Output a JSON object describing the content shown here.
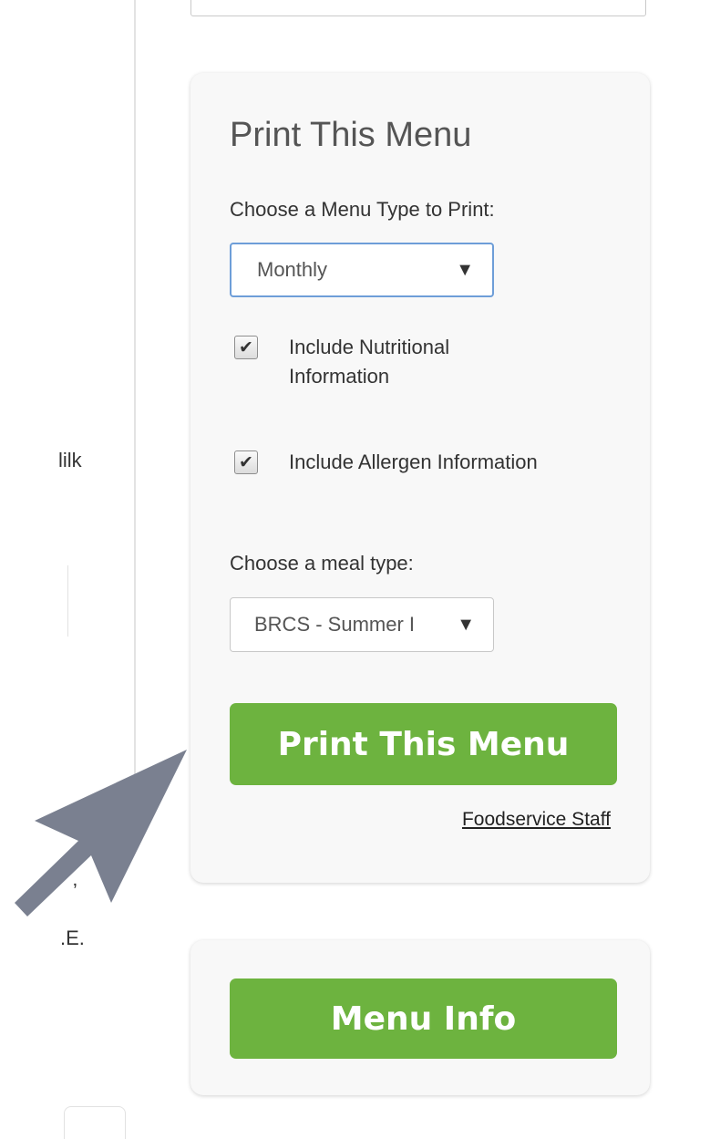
{
  "background_snippets": {
    "milk_fragment": "lilk",
    "dot_fragment": "ʼ",
    "e_fragment": ".E."
  },
  "print_card": {
    "title": "Print This Menu",
    "menu_type_label": "Choose a Menu Type to Print:",
    "menu_type_value": "Monthly",
    "nutritional_checkbox": {
      "label": "Include Nutritional Information",
      "checked_glyph": "✔"
    },
    "allergen_checkbox": {
      "label": "Include Allergen Information",
      "checked_glyph": "✔"
    },
    "meal_type_label": "Choose a meal type:",
    "meal_type_value": "BRCS - Summer I",
    "print_button_label": "Print This Menu",
    "staff_link": "Foodservice Staff"
  },
  "info_card": {
    "button_label": "Menu Info"
  },
  "icons": {
    "dropdown_arrow": "▼",
    "pointer": "annotation-arrow-icon"
  },
  "colors": {
    "green": "#6db33f",
    "arrow": "#7a8090",
    "focus_border": "#6e9ed8"
  }
}
